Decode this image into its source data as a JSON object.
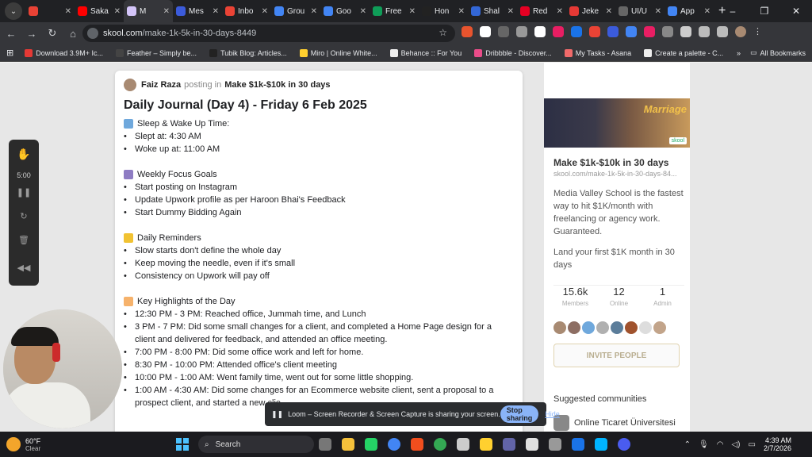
{
  "browser": {
    "tabs": [
      {
        "label": "",
        "color": "#e94235"
      },
      {
        "label": "Saka",
        "color": "#ff0000"
      },
      {
        "label": "M",
        "color": "#d4c5f9",
        "active": true
      },
      {
        "label": "Mes",
        "color": "#3b5bdb"
      },
      {
        "label": "Inbo",
        "color": "#ea4335"
      },
      {
        "label": "Grou",
        "color": "#4285f4"
      },
      {
        "label": "Goo",
        "color": "#4285f4"
      },
      {
        "label": "Free",
        "color": "#0f9d58"
      },
      {
        "label": "Hon",
        "color": "#222222"
      },
      {
        "label": "Shal",
        "color": "#3367d6"
      },
      {
        "label": "Red",
        "color": "#e60023"
      },
      {
        "label": "Jeke",
        "color": "#e53935"
      },
      {
        "label": "UI/U",
        "color": "#666666"
      },
      {
        "label": "App",
        "color": "#4285f4"
      }
    ],
    "new_tab": "+",
    "url_host": "skool.com",
    "url_path": "/make-1k-5k-in-30-days-8449",
    "bookmarks": [
      {
        "label": "Download 3.9M+ Ic...",
        "color": "#e53935"
      },
      {
        "label": "Feather – Simply be...",
        "color": "#444444"
      },
      {
        "label": "Tubik Blog: Articles...",
        "color": "#222222"
      },
      {
        "label": "Miro | Online White...",
        "color": "#ffd02f"
      },
      {
        "label": "Behance :: For You",
        "color": "#eeeeee"
      },
      {
        "label": "Dribbble - Discover...",
        "color": "#ea4c89"
      },
      {
        "label": "My Tasks - Asana",
        "color": "#f06a6a"
      },
      {
        "label": "Create a palette - C...",
        "color": "#eeeeee"
      }
    ],
    "all_bookmarks": "All Bookmarks"
  },
  "post": {
    "author": "Faiz Raza",
    "posting_in": "posting in",
    "group": "Make $1k-$10k in 30 days",
    "title": "Daily Journal (Day 4) - Friday 6 Feb 2025",
    "sections": [
      {
        "title": "Sleep & Wake Up Time:",
        "emoji_color": "#6fa8dc",
        "items": [
          "Slept at: 4:30 AM",
          "Woke up at: 11:00 AM"
        ]
      },
      {
        "title": "Weekly Focus Goals",
        "emoji_color": "#8e7cc3",
        "items": [
          "Start posting on Instagram",
          "Update Upwork profile as per Haroon Bhai's Feedback",
          "Start Dummy Bidding Again"
        ]
      },
      {
        "title": "Daily Reminders",
        "emoji_color": "#f1c232",
        "items": [
          "Slow starts don't define the whole day",
          "Keep moving the needle, even if it's small",
          "Consistency on Upwork will pay off"
        ]
      },
      {
        "title": "Key Highlights of the Day",
        "emoji_color": "#f6b26b",
        "items": [
          "12:30 PM - 3 PM: Reached office, Jummah time, and Lunch",
          "3 PM - 7 PM: Did some small changes for a client, and completed a Home Page design for a client and delivered for feedback, and attended an office meeting.",
          "7:00 PM - 8:00 PM: Did some office work and left for home.",
          "8:30 PM - 10:00 PM: Attended office's client meeting",
          "10:00 PM - 1:00 AM: Went family time, went out for some little shopping.",
          "1:00 AM - 4:30 AM: Did some changes for an Ecommerce website client, sent a proposal to a prospect client, and started a new clie"
        ]
      }
    ]
  },
  "sidebar": {
    "banner_text": "Marriage",
    "banner_tag": "skool",
    "title": "Make $1k-$10k in 30 days",
    "url": "skool.com/make-1k-5k-in-30-days-84...",
    "description": "Media Valley School is the fastest way to hit $1K/month with freelancing or agency work. Guaranteed.",
    "description2": "Land your first $1K month in 30 days",
    "stats": [
      {
        "value": "15.6k",
        "label": "Members"
      },
      {
        "value": "12",
        "label": "Online"
      },
      {
        "value": "1",
        "label": "Admin"
      }
    ],
    "invite_label": "INVITE PEOPLE",
    "suggested_title": "Suggested communities",
    "suggested_item": "Online Ticaret Üniversitesi"
  },
  "loom": {
    "timer": "5:00",
    "share_text": "Loom – Screen Recorder & Screen Capture is sharing your screen.",
    "stop_label": "Stop sharing",
    "hide_label": "Hide"
  },
  "taskbar": {
    "temp": "60°F",
    "condition": "Clear",
    "search_placeholder": "Search",
    "time": "4:39 AM",
    "date": "2/7/2026"
  }
}
